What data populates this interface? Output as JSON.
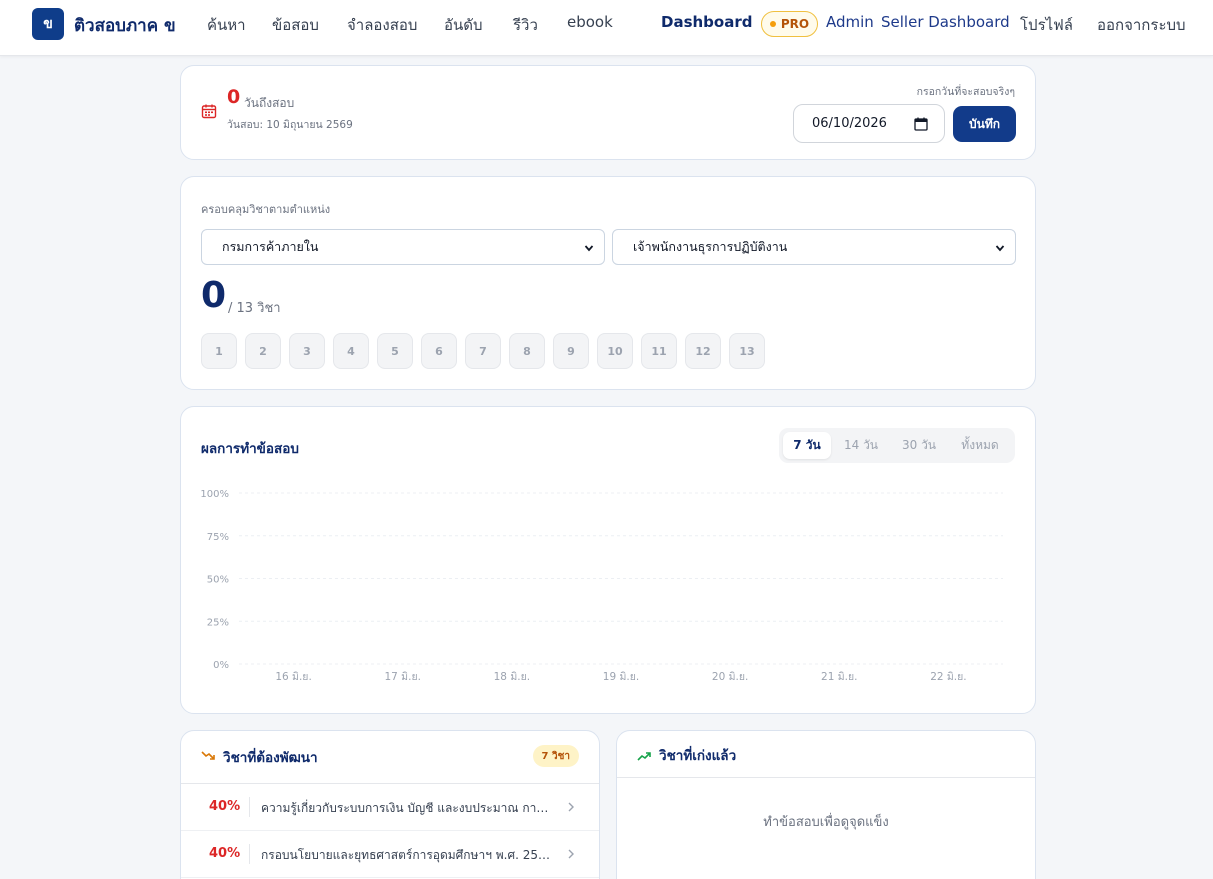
{
  "nav": {
    "brand_badge": "ข",
    "brand_name": "ติวสอบภาค ข",
    "links": [
      "ค้นหา",
      "ข้อสอบ",
      "จำลองสอบ",
      "อันดับ",
      "รีวิว",
      "ebook"
    ],
    "dashboard": "Dashboard",
    "pro_badge": "PRO",
    "admin": "Admin",
    "seller_dashboard": "Seller Dashboard",
    "profile": "โปรไฟล์",
    "logout": "ออกจากระบบ"
  },
  "countdown": {
    "days": "0",
    "days_label": "วันถึงสอบ",
    "exam_date_text": "วันสอบ: 10 มิถุนายน 2569",
    "hint": "กรอกวันที่จะสอบจริงๆ",
    "date_value": "06/10/2026",
    "save_label": "บันทึก"
  },
  "coverage": {
    "title": "ครอบคลุมวิชาตามตำแหน่ง",
    "department": "กรมการค้าภายใน",
    "position": "เจ้าพนักงานธุรการปฏิบัติงาน",
    "covered": "0",
    "total_text": "/ 13 วิชา",
    "subjects": [
      "1",
      "2",
      "3",
      "4",
      "5",
      "6",
      "7",
      "8",
      "9",
      "10",
      "11",
      "12",
      "13"
    ]
  },
  "results": {
    "title": "ผลการทำข้อสอบ",
    "ranges": [
      "7 วัน",
      "14 วัน",
      "30 วัน",
      "ทั้งหมด"
    ],
    "active_range": "7 วัน"
  },
  "chart_data": {
    "type": "line",
    "title": "ผลการทำข้อสอบ",
    "categories": [
      "16 มิ.ย.",
      "17 มิ.ย.",
      "18 มิ.ย.",
      "19 มิ.ย.",
      "20 มิ.ย.",
      "21 มิ.ย.",
      "22 มิ.ย."
    ],
    "y_ticks": [
      "100%",
      "75%",
      "50%",
      "25%",
      "0%"
    ],
    "ylim": [
      0,
      100
    ],
    "series": [],
    "grid": "horizontal-dashed"
  },
  "weak": {
    "title": "วิชาที่ต้องพัฒนา",
    "count_badge": "7 วิชา",
    "items": [
      {
        "pct": "40%",
        "name": "ความรู้เกี่ยวกับระบบการเงิน บัญชี และงบประมาณ การ..."
      },
      {
        "pct": "40%",
        "name": "กรอบนโยบายและยุทธศาสตร์การอุดมศึกษาฯ พ.ศ. 256..."
      }
    ]
  },
  "strong": {
    "title": "วิชาที่เก่งแล้ว",
    "empty_text": "ทำข้อสอบเพื่อดูจุดแข็ง"
  },
  "colors": {
    "navy": "#0f2a6b",
    "primary_button": "#123b8a",
    "danger": "#dc2626",
    "pro": "#f59e0b",
    "up_trend": "#16a34a",
    "down_trend": "#d97706"
  }
}
